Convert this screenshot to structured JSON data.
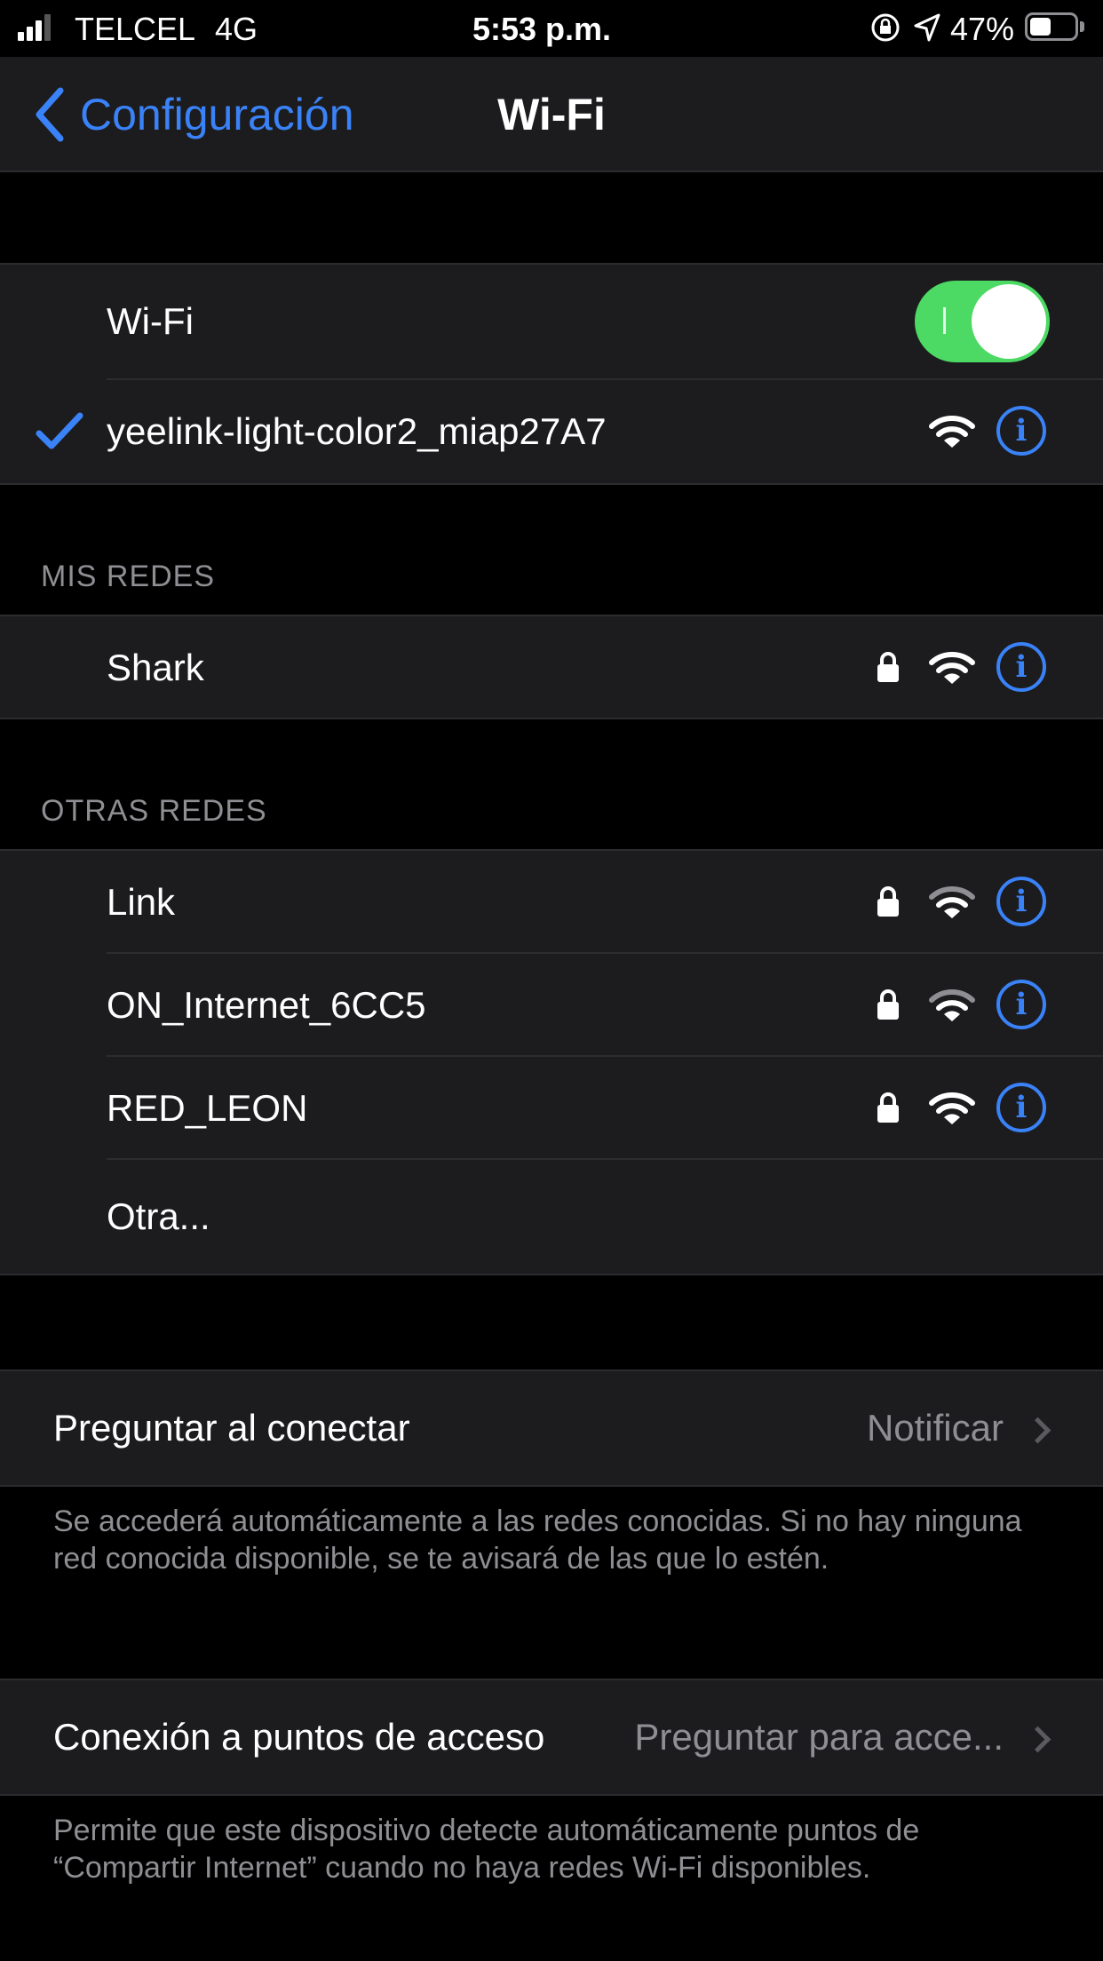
{
  "status_bar": {
    "carrier": "TELCEL",
    "network": "4G",
    "time": "5:53 p.m.",
    "battery_percent": "47%",
    "battery_level": 0.47,
    "signal_bars": 3
  },
  "nav": {
    "back_label": "Configuración",
    "title": "Wi-Fi"
  },
  "wifi": {
    "toggle_label": "Wi-Fi",
    "toggle_on": true,
    "connected_network": "yeelink-light-color2_miap27A7"
  },
  "my_networks": {
    "header": "MIS REDES",
    "items": [
      {
        "name": "Shark",
        "secured": true
      }
    ]
  },
  "other_networks": {
    "header": "OTRAS REDES",
    "items": [
      {
        "name": "Link",
        "secured": true
      },
      {
        "name": "ON_Internet_6CC5",
        "secured": true
      },
      {
        "name": "RED_LEON",
        "secured": true
      }
    ],
    "other_label": "Otra..."
  },
  "ask_to_join": {
    "label": "Preguntar al conectar",
    "value": "Notificar",
    "footnote": "Se accederá automáticamente a las redes conocidas. Si no hay ninguna red conocida disponible, se te avisará de las que lo estén."
  },
  "hotspot": {
    "label": "Conexión a puntos de acceso",
    "value": "Preguntar para acce...",
    "footnote": "Permite que este dispositivo detecte automáticamente puntos de “Compartir Internet” cuando no haya redes Wi-Fi disponibles."
  },
  "colors": {
    "accent": "#3a82f7",
    "toggle_on": "#4cd964",
    "cell_bg": "#1c1c1e",
    "secondary_text": "#8e8e93"
  },
  "icons": [
    "cellular-signal-icon",
    "rotation-lock-icon",
    "location-arrow-icon",
    "battery-icon",
    "back-chevron-icon",
    "checkmark-icon",
    "lock-icon",
    "wifi-signal-icon",
    "info-icon",
    "chevron-right-icon"
  ]
}
